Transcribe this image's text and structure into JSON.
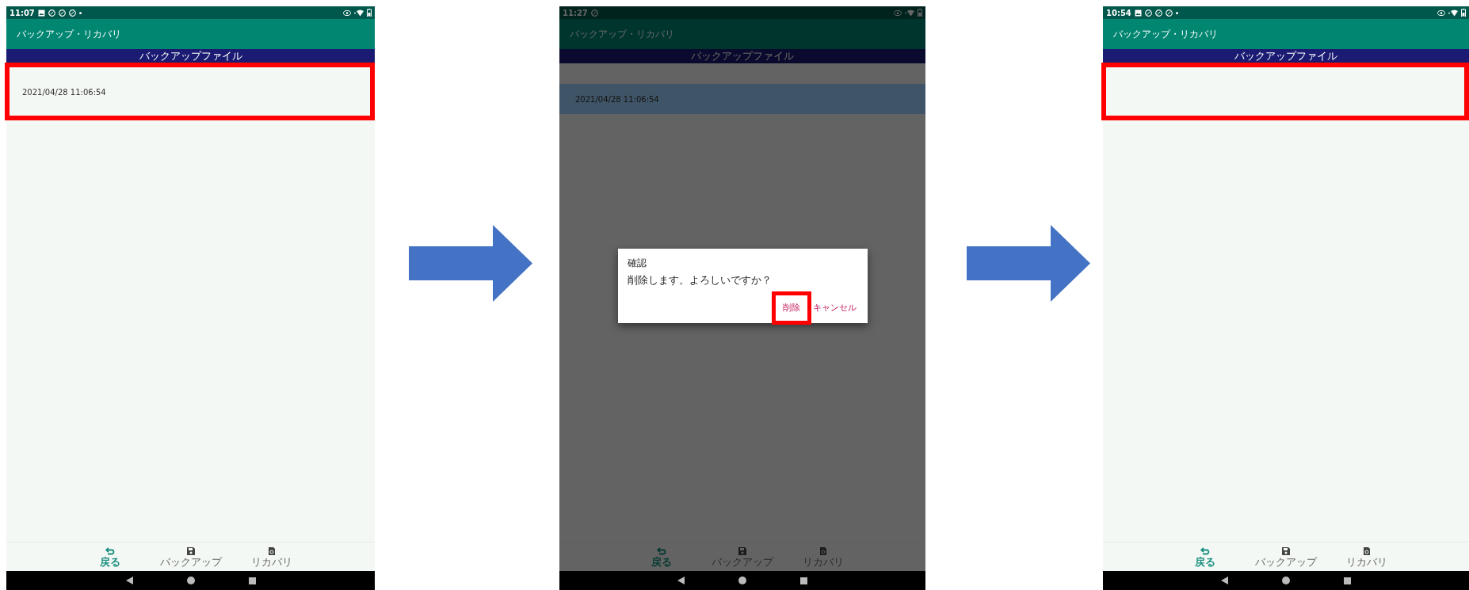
{
  "screens": [
    {
      "status_bar": {
        "time": "11:07",
        "notifications": [
          {
            "kind": "image"
          },
          {
            "kind": "circle"
          },
          {
            "kind": "circle"
          },
          {
            "kind": "circle"
          },
          {
            "kind": "dot"
          }
        ]
      },
      "app_bar": {
        "title": "バックアップ・リカバリ"
      },
      "section_header": "バックアップファイル",
      "files": [
        {
          "name": "2021/04/28 11:06:54",
          "selected": false
        }
      ],
      "highlight_list": true,
      "dimmed": false,
      "bottom_nav": [
        {
          "label": "戻る",
          "selected": true
        },
        {
          "label": "バックアップ",
          "selected": false
        },
        {
          "label": "リカバリ",
          "selected": false
        }
      ]
    },
    {
      "status_bar": {
        "time": "11:27",
        "notifications": [
          {
            "kind": "circle"
          }
        ]
      },
      "app_bar": {
        "title": "バックアップ・リカバリ"
      },
      "section_header": "バックアップファイル",
      "files": [
        {
          "name": "2021/04/28 11:06:54",
          "selected": true
        }
      ],
      "highlight_list": false,
      "dimmed": true,
      "dialog": {
        "title": "確認",
        "message": "削除します。よろしいですか？",
        "buttons": [
          {
            "label": "削除",
            "highlighted": true
          },
          {
            "label": "キャンセル",
            "highlighted": false
          }
        ]
      },
      "bottom_nav": [
        {
          "label": "戻る",
          "selected": true
        },
        {
          "label": "バックアップ",
          "selected": false
        },
        {
          "label": "リカバリ",
          "selected": false
        }
      ]
    },
    {
      "status_bar": {
        "time": "10:54",
        "notifications": [
          {
            "kind": "image"
          },
          {
            "kind": "circle"
          },
          {
            "kind": "circle"
          },
          {
            "kind": "circle"
          },
          {
            "kind": "dot"
          }
        ]
      },
      "app_bar": {
        "title": "バックアップ・リカバリ"
      },
      "section_header": "バックアップファイル",
      "highlight_list": true,
      "dimmed": false,
      "bottom_nav": [
        {
          "label": "戻る",
          "selected": true
        },
        {
          "label": "バックアップ",
          "selected": false
        },
        {
          "label": "リカバリ",
          "selected": false
        }
      ]
    }
  ]
}
